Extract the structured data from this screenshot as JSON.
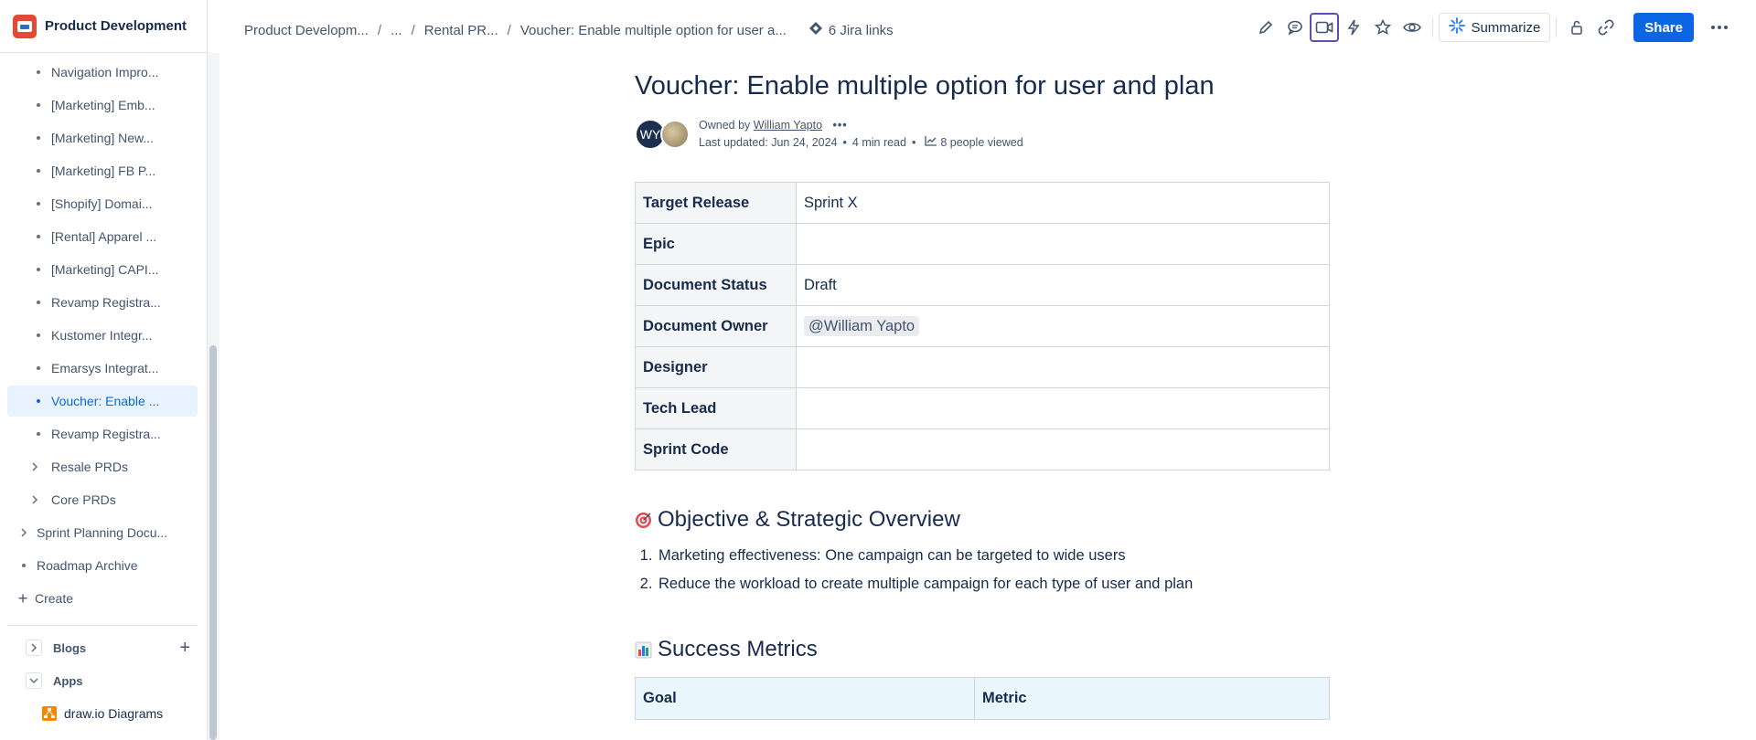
{
  "space": {
    "title": "Product Development"
  },
  "sidebar": {
    "items": [
      {
        "label": "Navigation Impro..."
      },
      {
        "label": "[Marketing] Emb..."
      },
      {
        "label": "[Marketing] New..."
      },
      {
        "label": "[Marketing] FB P..."
      },
      {
        "label": "[Shopify] Domai..."
      },
      {
        "label": "[Rental] Apparel ..."
      },
      {
        "label": "[Marketing] CAPI..."
      },
      {
        "label": "Revamp Registra..."
      },
      {
        "label": "Kustomer Integr..."
      },
      {
        "label": "Emarsys Integrat..."
      },
      {
        "label": "Voucher: Enable ..."
      },
      {
        "label": "Revamp Registra..."
      }
    ],
    "resale": "Resale PRDs",
    "core": "Core PRDs",
    "sprint": "Sprint Planning Docu...",
    "roadmap": "Roadmap Archive",
    "create": "Create",
    "blogs": "Blogs",
    "apps": "Apps",
    "drawio": "draw.io Diagrams"
  },
  "breadcrumbs": {
    "c1": "Product Developm...",
    "c2": "...",
    "c3": "Rental PR...",
    "c4": "Voucher: Enable multiple option for user a...",
    "sep": "/",
    "jira": "6 Jira links"
  },
  "toolbar": {
    "summarize": "Summarize",
    "share": "Share"
  },
  "page": {
    "title": "Voucher: Enable multiple option for user and plan",
    "avatar_initials": "WY",
    "owned_by": "Owned by",
    "owner": "William Yapto",
    "last_updated": "Last updated: Jun 24, 2024",
    "read_time": "4 min read",
    "viewed": "8 people viewed"
  },
  "props": [
    {
      "key": "Target Release",
      "value": "Sprint X"
    },
    {
      "key": "Epic",
      "value": ""
    },
    {
      "key": "Document Status",
      "value": "Draft"
    },
    {
      "key": "Document Owner",
      "value": "@William Yapto"
    },
    {
      "key": "Designer",
      "value": ""
    },
    {
      "key": "Tech Lead",
      "value": ""
    },
    {
      "key": "Sprint Code",
      "value": ""
    }
  ],
  "objective": {
    "heading": "Objective & Strategic Overview",
    "items": [
      "Marketing effectiveness: One campaign can be targeted to wide users",
      "Reduce the workload to create multiple campaign for each type of user and plan"
    ]
  },
  "metrics": {
    "heading": "Success Metrics",
    "col_goal": "Goal",
    "col_metric": "Metric"
  },
  "colors": {
    "accent": "#0c66e4",
    "active_bg": "#e9f2ff",
    "logo": "#e34935"
  }
}
